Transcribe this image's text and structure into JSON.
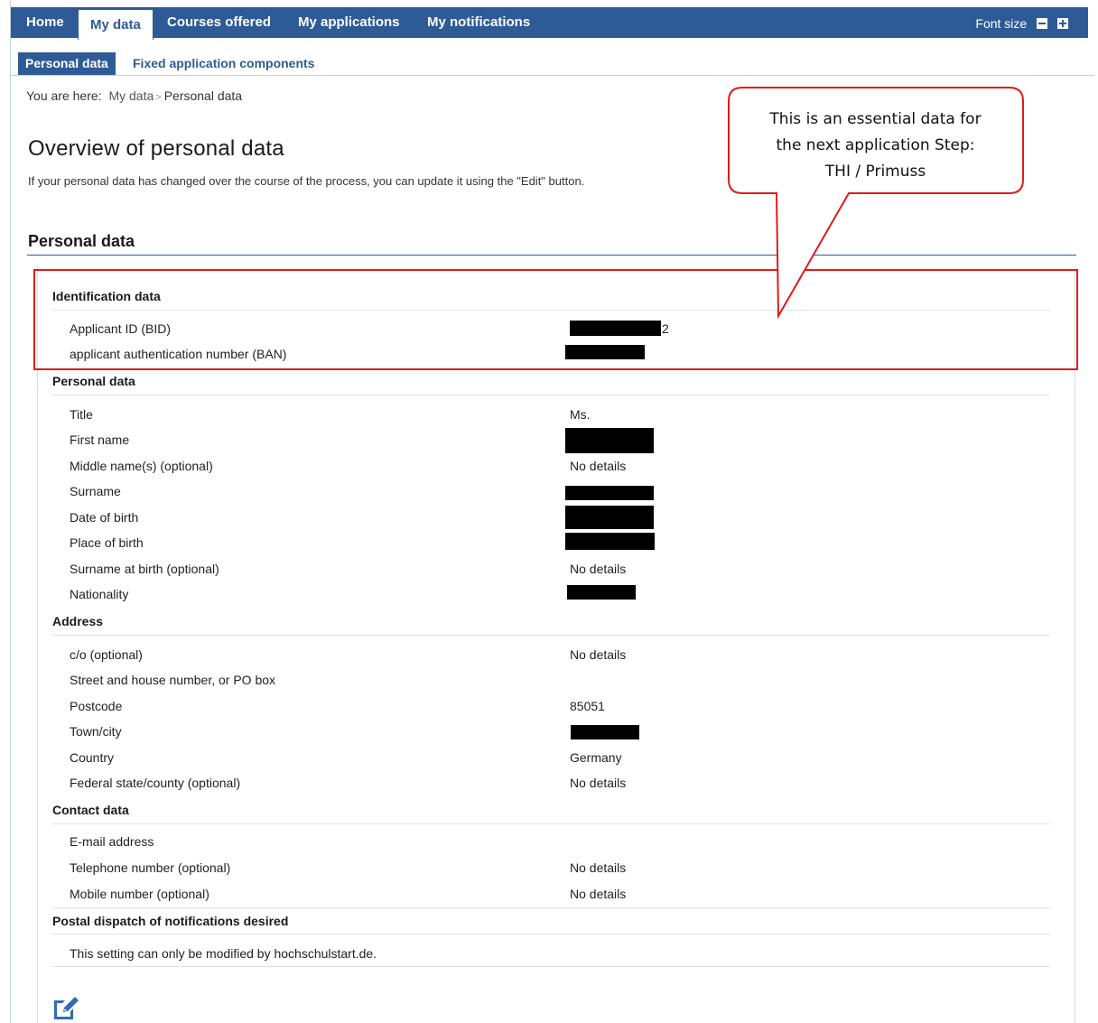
{
  "nav": {
    "tabs": [
      "Home",
      "My data",
      "Courses offered",
      "My applications",
      "My notifications"
    ],
    "font_size_label": "Font size"
  },
  "subnav": {
    "tabs": [
      "Personal data",
      "Fixed application components"
    ]
  },
  "breadcrumb": {
    "prefix": "You are here:",
    "items": [
      "My data",
      "Personal data"
    ]
  },
  "page": {
    "title": "Overview of personal data",
    "intro": "If your personal data has changed over the course of the process, you can update it using the \"Edit\" button.",
    "section_title": "Personal data"
  },
  "groups": {
    "identification": {
      "title": "Identification data",
      "rows": [
        {
          "label": "Applicant ID (BID)",
          "value": "2"
        },
        {
          "label": "applicant authentication number (BAN)",
          "value": ""
        }
      ]
    },
    "personal": {
      "title": "Personal data",
      "rows": [
        {
          "label": "Title",
          "value": "Ms."
        },
        {
          "label": "First name",
          "value": ""
        },
        {
          "label": "Middle name(s) (optional)",
          "value": "No details"
        },
        {
          "label": "Surname",
          "value": ""
        },
        {
          "label": "Date of birth",
          "value": ""
        },
        {
          "label": "Place of birth",
          "value": ""
        },
        {
          "label": "Surname at birth (optional)",
          "value": "No details"
        },
        {
          "label": "Nationality",
          "value": ""
        }
      ]
    },
    "address": {
      "title": "Address",
      "rows": [
        {
          "label": "c/o (optional)",
          "value": "No details"
        },
        {
          "label": "Street and house number, or PO box",
          "value": ""
        },
        {
          "label": "Postcode",
          "value": "85051"
        },
        {
          "label": "Town/city",
          "value": ""
        },
        {
          "label": "Country",
          "value": "Germany"
        },
        {
          "label": "Federal state/county (optional)",
          "value": "No details"
        }
      ]
    },
    "contact": {
      "title": "Contact data",
      "rows": [
        {
          "label": "E-mail address",
          "value": ""
        },
        {
          "label": "Telephone number (optional)",
          "value": "No details"
        },
        {
          "label": "Mobile number (optional)",
          "value": "No details"
        }
      ]
    },
    "postal": {
      "title": "Postal dispatch of notifications desired",
      "note": "This setting can only be modified by hochschulstart.de."
    }
  },
  "callout": {
    "lines": [
      "This is an essential data for",
      "the next application Step:",
      "THI / Primuss"
    ],
    "color": "#e01b1b"
  },
  "icons": {
    "edit": "edit-icon"
  },
  "colors": {
    "nav_bg": "#2e5b96",
    "annotation_red": "#e01b1b"
  }
}
